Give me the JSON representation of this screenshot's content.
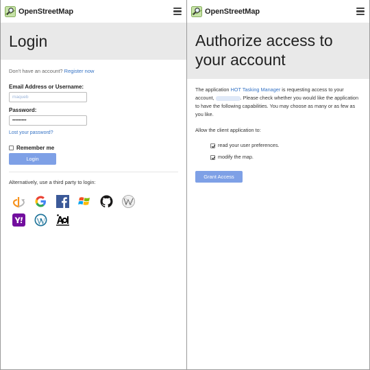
{
  "login_screen": {
    "brand": "OpenStreetMap",
    "title": "Login",
    "no_account_text": "Don't have an account?",
    "register_link": "Register now",
    "email_label": "Email Address or Username:",
    "email_value": "maqueb",
    "password_label": "Password:",
    "password_value": "•••••••••",
    "lost_password": "Lost your password?",
    "remember_me": "Remember me",
    "login_button": "Login",
    "third_party_text": "Alternatively, use a third party to login:",
    "providers": [
      "openid-icon",
      "google-icon",
      "facebook-icon",
      "microsoft-icon",
      "github-icon",
      "wikipedia-icon",
      "yahoo-icon",
      "wordpress-icon",
      "aol-icon"
    ]
  },
  "authorize_screen": {
    "brand": "OpenStreetMap",
    "title": "Authorize access to your account",
    "intro_pre": "The application",
    "app_name": "HOT Tasking Manager",
    "intro_mid": "is requesting access to your account,",
    "intro_post": ". Please check whether you would like the application to have the following capabilities. You may choose as many or as few as you like.",
    "allow_text": "Allow the client application to:",
    "permissions": [
      {
        "label": "read your user preferences.",
        "checked": true
      },
      {
        "label": "modify the map.",
        "checked": true
      }
    ],
    "grant_button": "Grant Access"
  },
  "colors": {
    "button": "#7ea0e6",
    "link": "#3472c4",
    "hero_bg": "#e9e9e9"
  }
}
